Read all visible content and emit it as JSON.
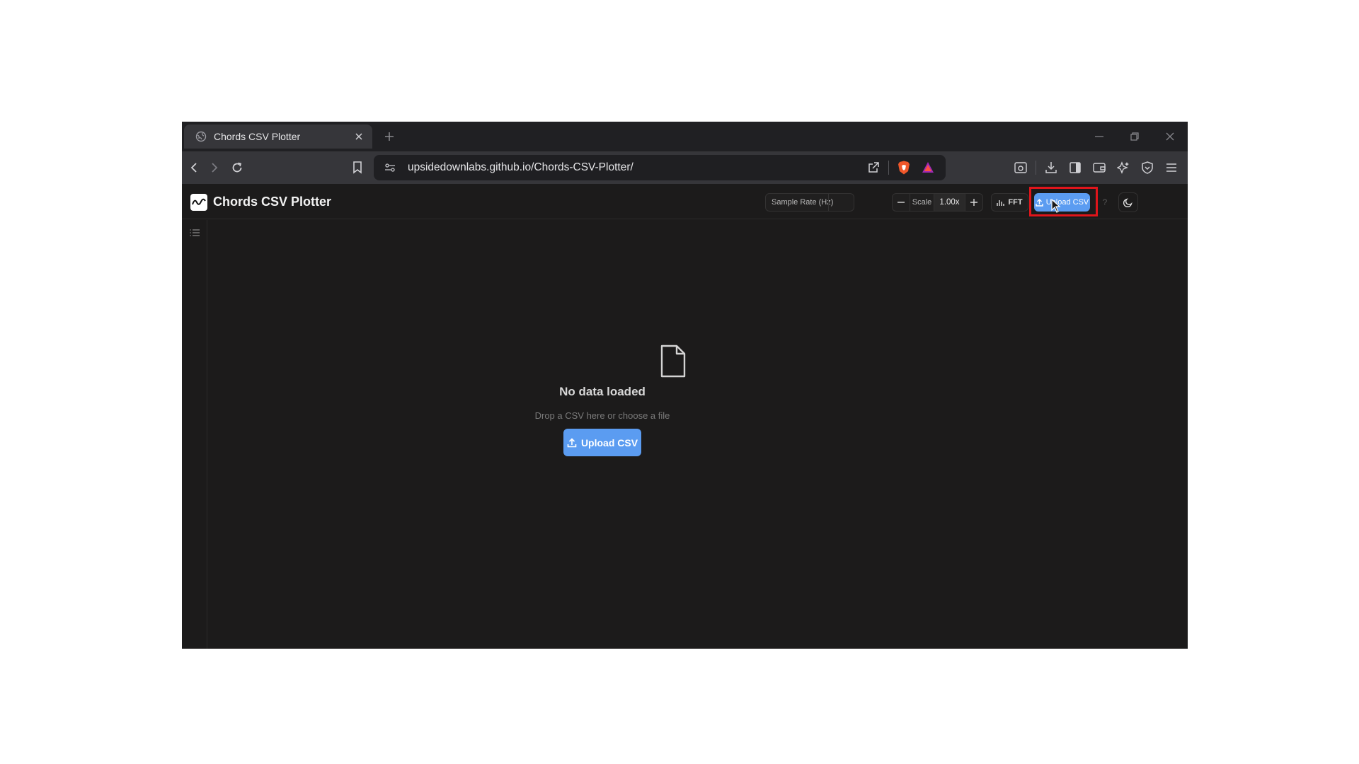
{
  "browser": {
    "tab": {
      "title": "Chords CSV Plotter"
    },
    "url": "upsidedownlabs.github.io/Chords-CSV-Plotter/"
  },
  "app": {
    "title": "Chords CSV Plotter",
    "sample_rate_label": "Sample Rate (Hz)",
    "sample_rate_value": "",
    "scale_label": "Scale",
    "scale_value": "1.00x",
    "fft_label": "FFT",
    "upload_label": "Upload CSV",
    "help_label": "?"
  },
  "empty_state": {
    "title": "No data loaded",
    "subtitle": "Drop a CSV here or choose a file",
    "button_label": "Upload CSV"
  },
  "colors": {
    "accent": "#5b9cf1",
    "background": "#1c1b1b",
    "highlight": "#e0151b"
  }
}
